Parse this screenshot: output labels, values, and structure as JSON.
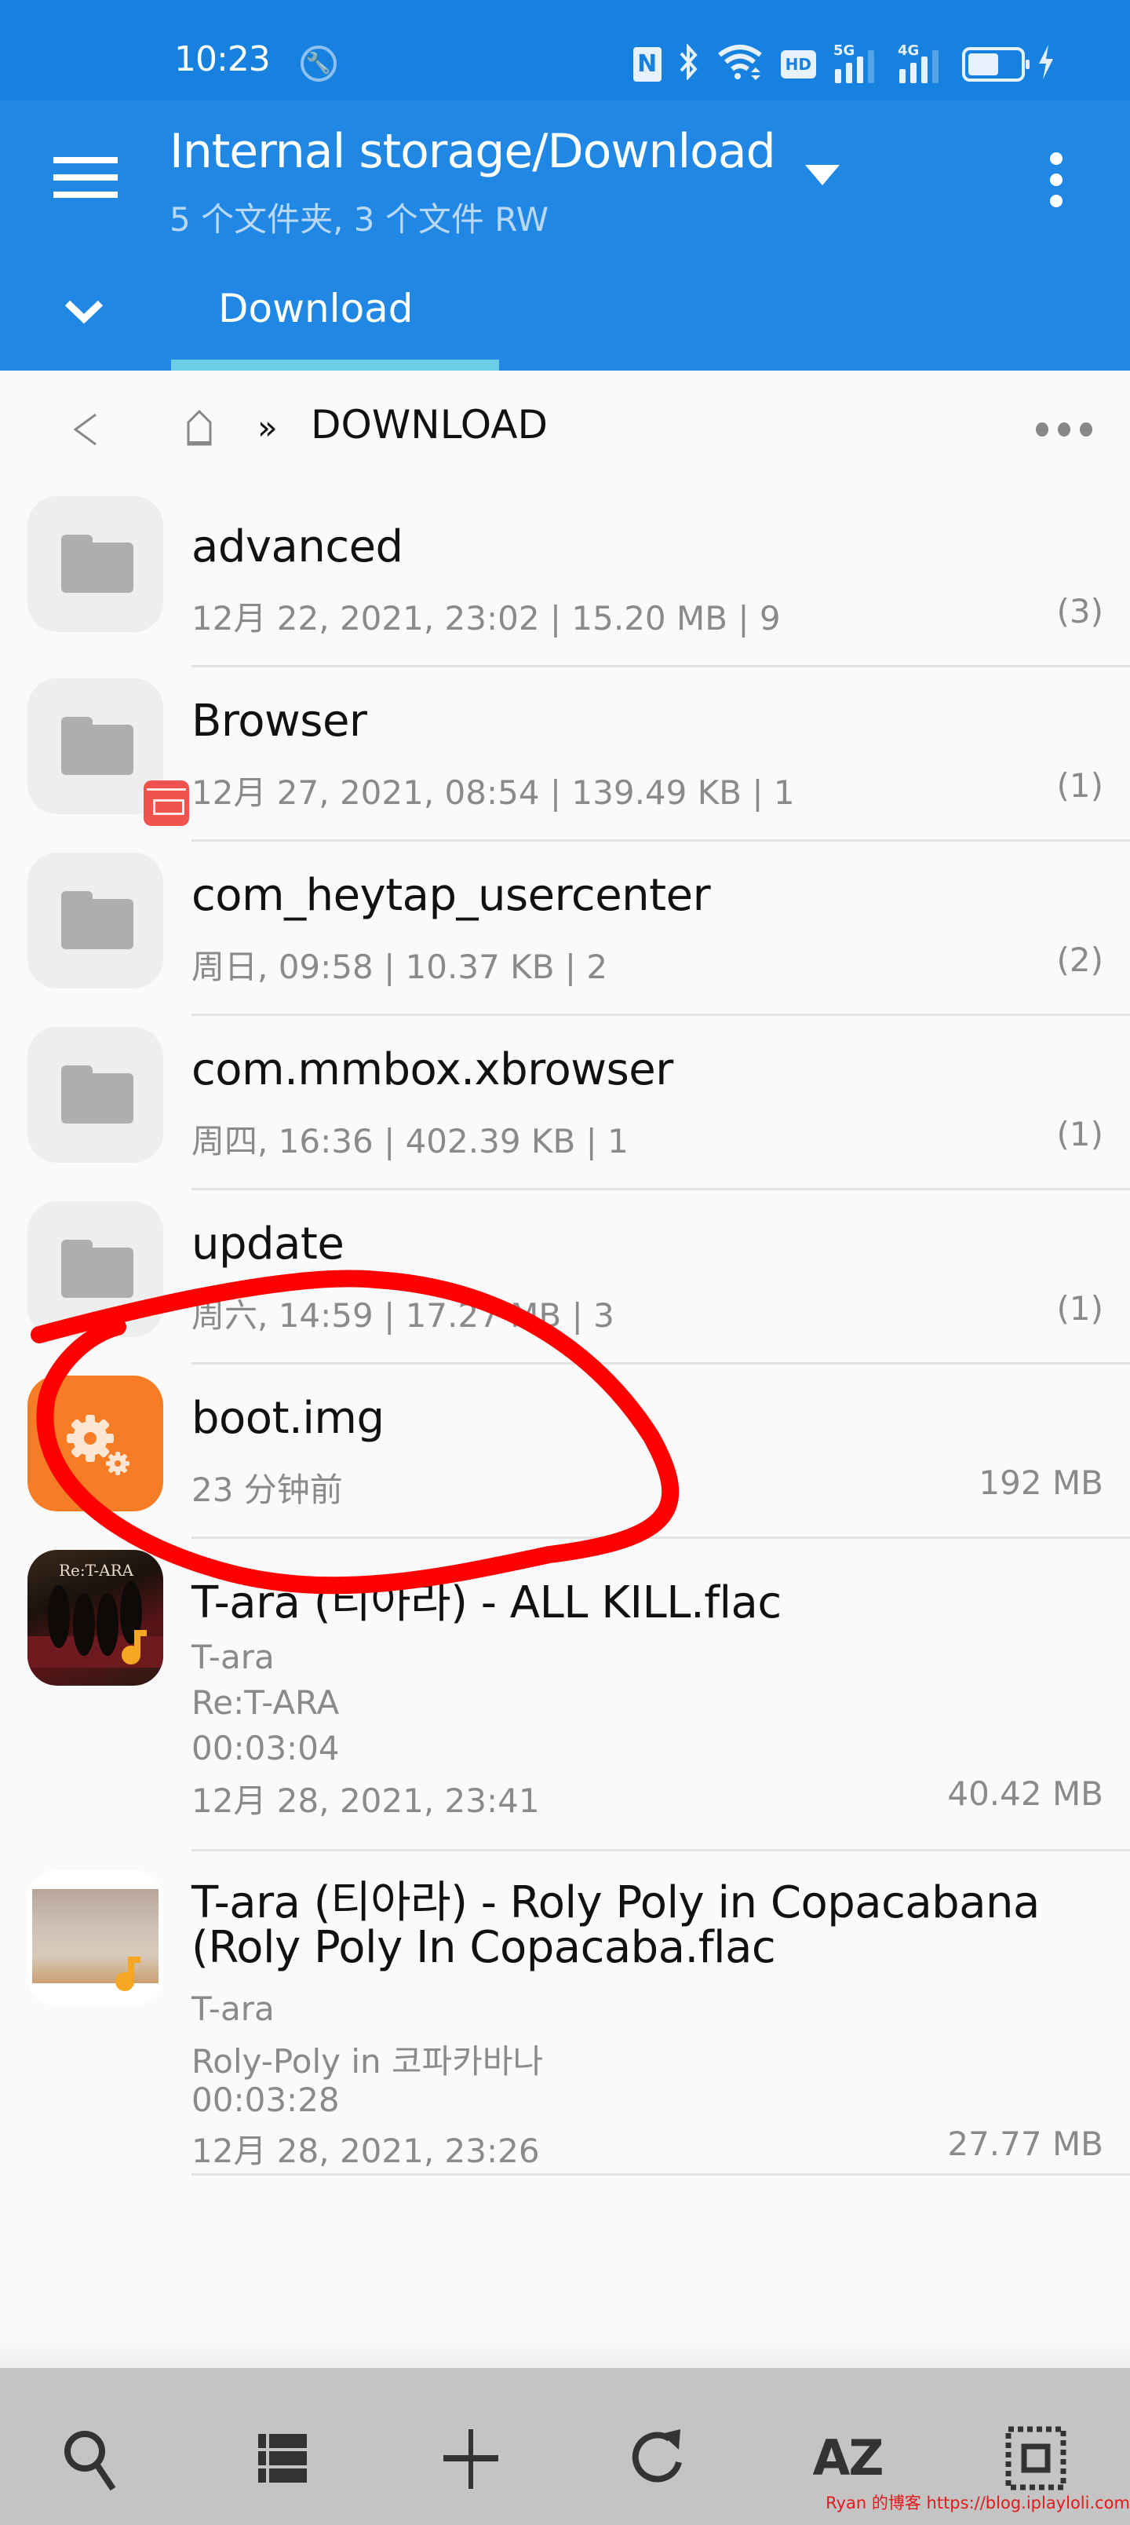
{
  "status_bar": {
    "time": "10:23",
    "icons": [
      "wrench-icon",
      "nfc-icon",
      "bluetooth-icon",
      "wifi-icon",
      "hd-voice-icon",
      "signal-5g-icon",
      "signal-4g-icon",
      "battery-icon",
      "charging-icon"
    ],
    "nfc_label": "N",
    "hd_label": "HD",
    "net1_label": "5G",
    "net2_label": "4G",
    "battery_level_fraction": 0.5
  },
  "app_bar": {
    "title": "Internal storage/Download",
    "subtitle": "5 个文件夹, 3 个文件 RW",
    "tabs": [
      {
        "label": "Download",
        "active": true
      }
    ],
    "accent_color": "#2088E4",
    "tab_indicator_color": "#6ACFE6"
  },
  "breadcrumb": {
    "separator": "»",
    "current": "DOWNLOAD"
  },
  "items": [
    {
      "type": "folder",
      "name": "advanced",
      "meta": "12月 22, 2021, 23:02 | 15.20 MB | 9",
      "right": "(3)"
    },
    {
      "type": "folder",
      "name": "Browser",
      "meta": "12月 27, 2021, 08:54 | 139.49  KB | 1",
      "right": "(1)",
      "badge": "browser-app-badge"
    },
    {
      "type": "folder",
      "name": "com_heytap_usercenter",
      "meta": "周日, 09:58 | 10.37  KB | 2",
      "right": "(2)"
    },
    {
      "type": "folder",
      "name": "com.mmbox.xbrowser",
      "meta": "周四, 16:36 | 402.39  KB | 1",
      "right": "(1)"
    },
    {
      "type": "folder",
      "name": "update",
      "meta": "周六, 14:59 | 17.27 MB | 3",
      "right": "(1)"
    },
    {
      "type": "file",
      "name": "boot.img",
      "meta": "23 分钟前",
      "right": "192 MB",
      "icon": "gears-icon",
      "icon_color": "#F67C26"
    },
    {
      "type": "audio",
      "name": "T-ara (티아라) - ALL KILL.flac",
      "artist": "T-ara",
      "album": "Re:T-ARA",
      "duration": "00:03:04",
      "date": "12月 28, 2021, 23:41",
      "right": "40.42 MB",
      "art_text": "Re:T-ARA"
    },
    {
      "type": "audio",
      "name_line1": "T-ara (티아라) - Roly Poly in Copacabana",
      "name_line2": "(Roly Poly In Copacaba.flac",
      "artist": "T-ara",
      "album": "Roly-Poly in 코파카바나",
      "duration": "00:03:28",
      "date": "12月 28, 2021, 23:26",
      "right": "27.77 MB"
    }
  ],
  "toolbar": {
    "buttons": [
      "search",
      "list-view",
      "add",
      "refresh",
      "sort",
      "select-all"
    ],
    "sort_label": "AZ"
  },
  "annotation": {
    "color": "#FF0000",
    "target": "boot.img"
  },
  "watermark": "Ryan 的博客 https://blog.iplayloli.com"
}
